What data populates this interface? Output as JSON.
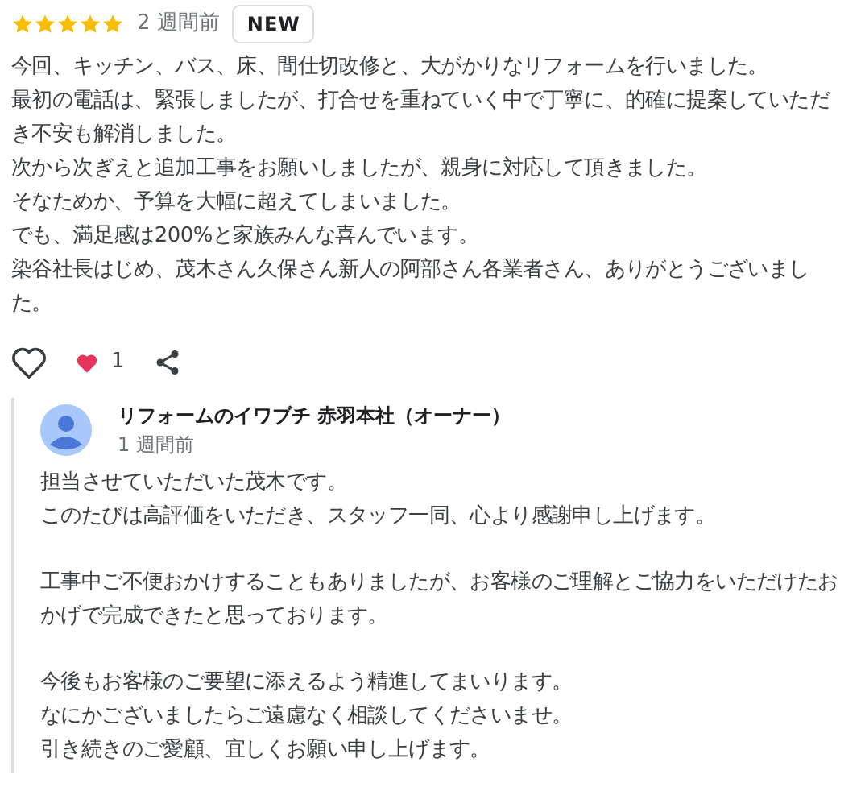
{
  "review": {
    "stars": 5,
    "time": "2 週間前",
    "badge": "NEW",
    "paragraphs": [
      "今回、キッチン、バス、床、間仕切改修と、大がかりなリフォームを行いました。",
      "最初の電話は、緊張しましたが、打合せを重ねていく中で丁寧に、的確に提案していただき不安も解消しました。",
      "次から次ぎえと追加工事をお願いしましたが、親身に対応して頂きました。",
      "そなためか、予算を大幅に超えてしまいました。",
      "でも、満足感は200%と家族みんな喜んでいます。",
      "染谷社長はじめ、茂木さん久保さん新人の阿部さん各業者さん、ありがとうございました。"
    ]
  },
  "actions": {
    "liked": false,
    "reaction_count": "1"
  },
  "reply": {
    "author": "リフォームのイワブチ 赤羽本社（オーナー）",
    "time": "1 週間前",
    "blocks": [
      [
        "担当させていただいた茂木です。",
        "このたびは高評価をいただき、スタッフ一同、心より感謝申し上げます。"
      ],
      [
        "工事中ご不便おかけすることもありましたが、お客様のご理解とご協力をいただけたおかげで完成できたと思っております。"
      ],
      [
        "今後もお客様のご要望に添えるよう精進してまいります。",
        "なにかございましたらご遠慮なく相談してくださいませ。",
        "引き続きのご愛顧、宜しくお願い申し上げます。"
      ]
    ]
  }
}
